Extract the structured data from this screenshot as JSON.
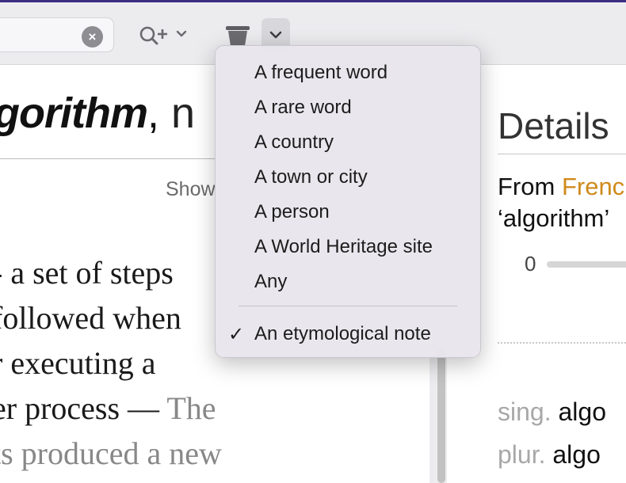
{
  "toolbar": {
    "clear_glyph": "×",
    "icons": [
      "clear-search-icon",
      "zoom-plus-icon",
      "chevron-down-icon",
      "trash-icon",
      "chevron-down-icon"
    ]
  },
  "article": {
    "headword": "gorithm",
    "headword_suffix": ",",
    "pos": " n",
    "show_label": "Show",
    "definition_lines": [
      "- a set of steps",
      "followed when",
      "r executing a",
      "er process —"
    ],
    "example_lines": [
      " The",
      "ts produced a new"
    ]
  },
  "details": {
    "title": "Details",
    "from_label": "From ",
    "from_lang": "Frenc",
    "quote": "‘algorithm’",
    "slider_min": "0",
    "inflections": [
      {
        "label": "sing.",
        "value": " algo"
      },
      {
        "label": "plur.",
        "value": " algo"
      }
    ]
  },
  "menu": {
    "items": [
      {
        "label": "A frequent word"
      },
      {
        "label": "A rare word"
      },
      {
        "label": "A country"
      },
      {
        "label": "A town or city"
      },
      {
        "label": "A person"
      },
      {
        "label": "A World Heritage site"
      },
      {
        "label": "Any"
      }
    ],
    "checked_item": {
      "label": "An etymological note",
      "check": "✓"
    }
  },
  "colors": {
    "accent_window_top": "#3b2f83",
    "etymology_language": "#d08a1c"
  }
}
